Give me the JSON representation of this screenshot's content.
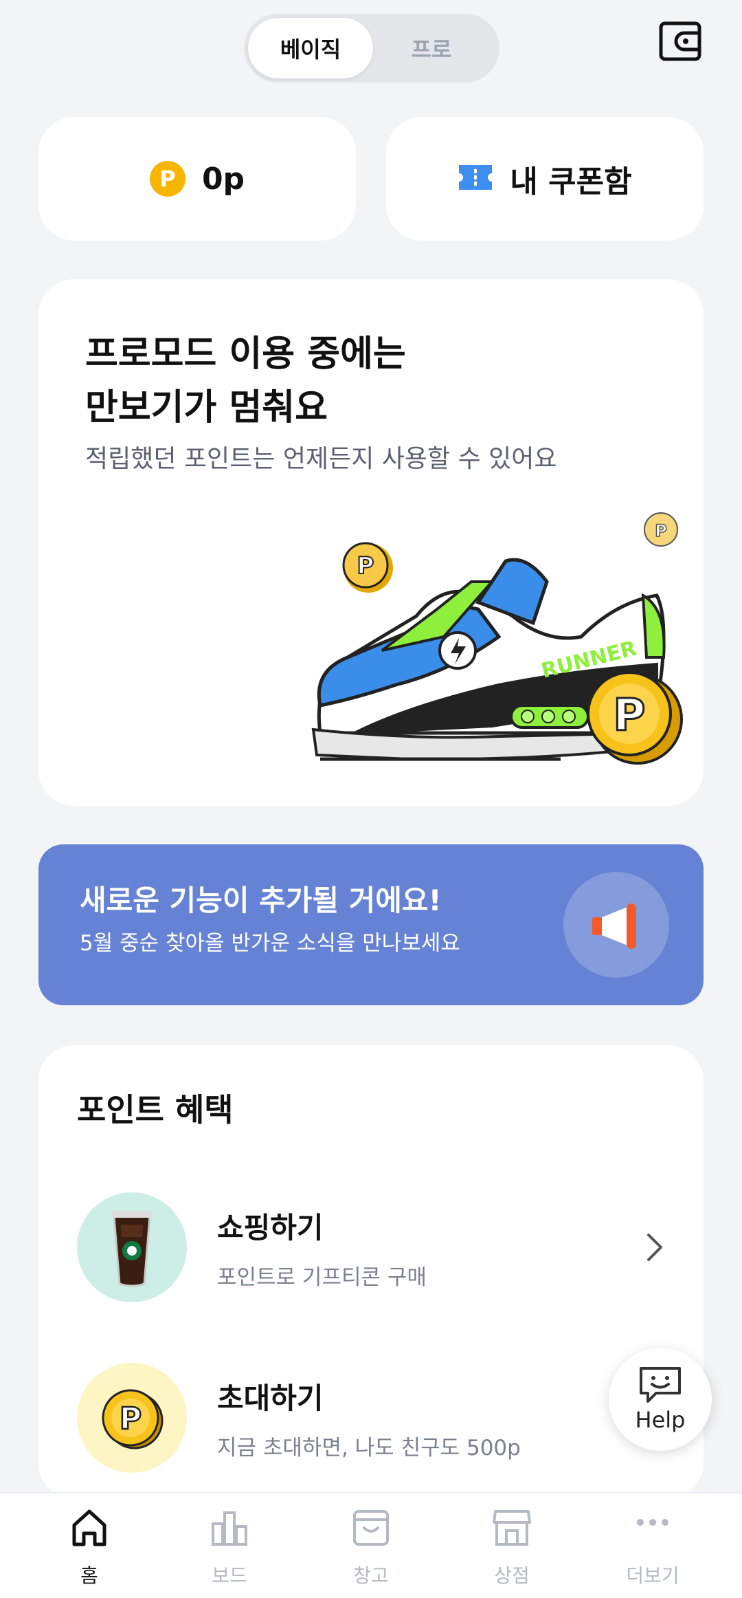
{
  "mode_toggle": {
    "basic": "베이직",
    "pro": "프로"
  },
  "points_pill": {
    "coin_letter": "P",
    "value": "0p"
  },
  "coupon_pill": {
    "label": "내 쿠폰함"
  },
  "hero": {
    "title_line1": "프로모드 이용 중에는",
    "title_line2": "만보기가 멈춰요",
    "subtitle": "적립했던 포인트는 언제든지 사용할 수 있어요",
    "shoe_text": "RUNNER"
  },
  "banner": {
    "title": "새로운 기능이 추가될 거에요!",
    "subtitle": "5월 중순 찾아올 반가운 소식을 만나보세요"
  },
  "benefits": {
    "title": "포인트 혜택",
    "items": [
      {
        "title": "쇼핑하기",
        "subtitle": "포인트로 기프티콘 구매",
        "icon": "iced-coffee-icon"
      },
      {
        "title": "초대하기",
        "subtitle": "지금 초대하면, 나도 친구도 500p",
        "icon": "coin-icon"
      }
    ]
  },
  "help": {
    "label": "Help"
  },
  "nav": {
    "items": [
      {
        "label": "홈",
        "icon": "home-icon",
        "active": true
      },
      {
        "label": "보드",
        "icon": "chart-icon",
        "active": false
      },
      {
        "label": "창고",
        "icon": "box-icon",
        "active": false
      },
      {
        "label": "상점",
        "icon": "store-icon",
        "active": false
      },
      {
        "label": "더보기",
        "icon": "more-icon",
        "active": false
      }
    ]
  },
  "colors": {
    "accent": "#6682d4",
    "coin": "#f8b500",
    "background": "#f3f4f6"
  }
}
